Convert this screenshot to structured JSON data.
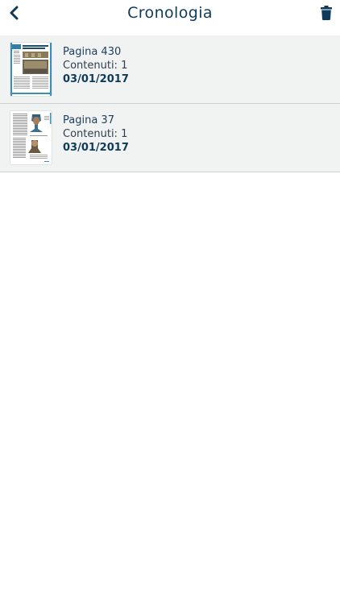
{
  "header": {
    "title": "Cronologia",
    "back_icon": "chevron-left-icon",
    "trash_icon": "trash-icon"
  },
  "history": {
    "items": [
      {
        "page": "Pagina 430",
        "contents": "Contenuti: 1",
        "date": "03/01/2017",
        "thumbnail": "page-thumbnail"
      },
      {
        "page": "Pagina 37",
        "contents": "Contenuti: 1",
        "date": "03/01/2017",
        "thumbnail": "page-thumbnail"
      }
    ]
  },
  "colors": {
    "accent": "#0e3b5a",
    "row_background": "#f1f2f2",
    "divider": "#cdd0d2"
  }
}
